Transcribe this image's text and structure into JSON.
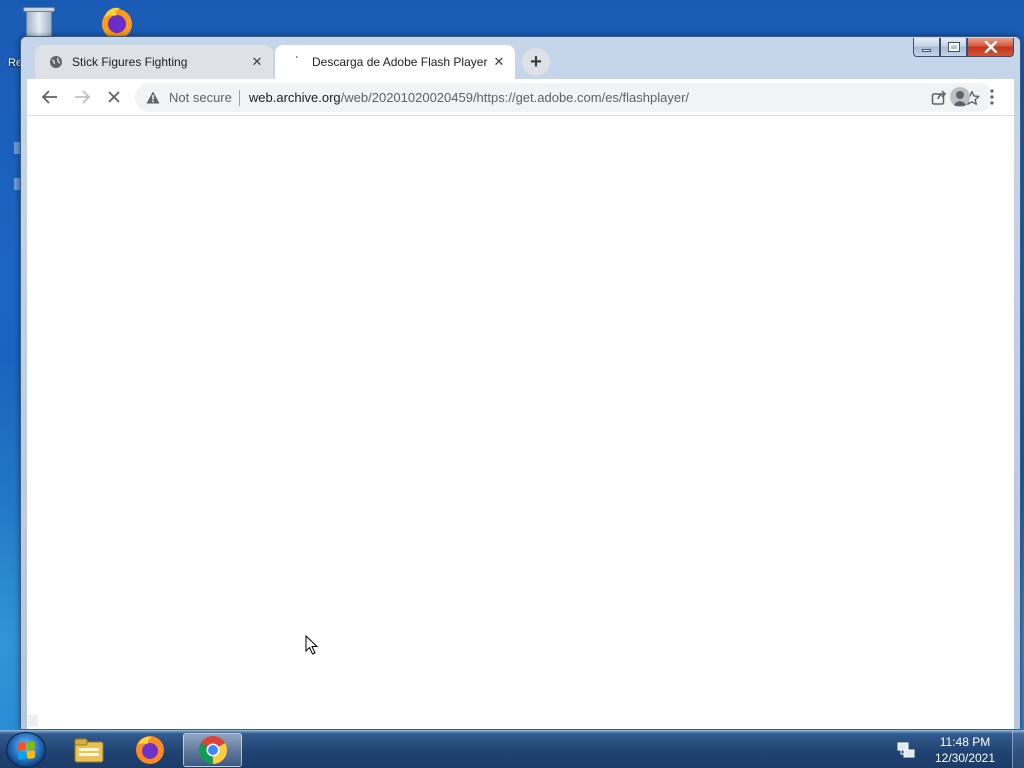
{
  "desktop": {
    "label_partial": "Re"
  },
  "browser": {
    "tabs": [
      {
        "title": "Stick Figures Fighting",
        "icon": "globe-icon",
        "active": false
      },
      {
        "title": "Descarga de Adobe Flash Player",
        "icon": "loading-spinner-icon",
        "active": true
      }
    ],
    "new_tab_label": "+",
    "toolbar": {
      "security_text": "Not secure",
      "url_host": "web.archive.org",
      "url_path": "/web/20201020020459/https://get.adobe.com/es/flashplayer/"
    }
  },
  "taskbar": {
    "apps": [
      "windows-explorer-icon",
      "firefox-icon",
      "chrome-icon"
    ],
    "active_app": "chrome-icon",
    "clock": {
      "time": "11:48 PM",
      "date": "12/30/2021"
    }
  },
  "colors": {
    "chrome_tab_inactive": "#dee1e6",
    "chrome_toolbar": "#ffffff",
    "omnibox": "#f1f3f4",
    "win7_close": "#c2351a"
  }
}
